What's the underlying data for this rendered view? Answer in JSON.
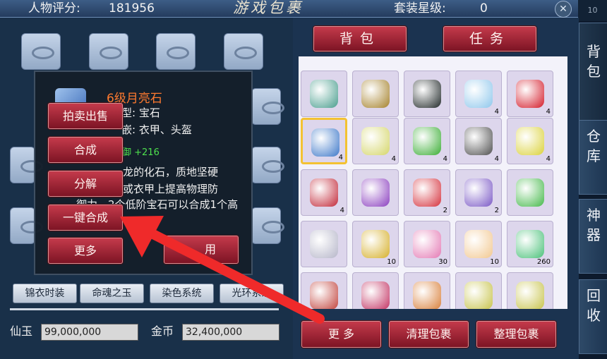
{
  "header": {
    "rating_label": "人物评分:",
    "rating_value": "181956",
    "title": "游戏包裹",
    "set_level_label": "套装星级:",
    "set_level_value": "0",
    "close_symbol": "✕",
    "edge_text": "10"
  },
  "tooltip": {
    "name": "6级月亮石",
    "type_line": "型: 宝石",
    "inlay_line": "嵌: 衣甲、头盔",
    "bonus": "御 +216",
    "desc_l1": "龙的化石，质地坚硬",
    "desc_l2": "或衣甲上提高物理防",
    "desc_l3": "御力。2个低阶宝石可以合成1个高",
    "desc_l4": "用"
  },
  "context_menu": {
    "auction": "拍卖出售",
    "compose": "合成",
    "split": "分解",
    "one_key_compose": "一键合成",
    "more": "更多"
  },
  "left_tabs": [
    "锦衣时装",
    "命魂之玉",
    "染色系统",
    "光环系统"
  ],
  "currency": {
    "xianyu_label": "仙玉",
    "xianyu_value": "99,000,000",
    "gold_label": "金币",
    "gold_value": "32,400,000"
  },
  "bag_tabs": {
    "bag": "背包",
    "task": "任务"
  },
  "items": [
    {
      "icon": "armor-icon",
      "count": "",
      "color": "#4a9e8e"
    },
    {
      "icon": "ring-icon",
      "count": "",
      "color": "#a5822c"
    },
    {
      "icon": "boots-icon",
      "count": "",
      "color": "#222a2a"
    },
    {
      "icon": "ice-flower-icon",
      "count": "4",
      "color": "#8ec7ec"
    },
    {
      "icon": "red-gem-icon",
      "count": "4",
      "color": "#d41c2a"
    },
    {
      "icon": "moonstone-icon",
      "count": "4",
      "color": "#3d78c9",
      "selected": true
    },
    {
      "icon": "eggs-icon",
      "count": "4",
      "color": "#d5d66a"
    },
    {
      "icon": "green-gem-icon",
      "count": "4",
      "color": "#3cae36"
    },
    {
      "icon": "black-gem-icon",
      "count": "4",
      "color": "#505050"
    },
    {
      "icon": "yellow-gem-icon",
      "count": "4",
      "color": "#dbd23b"
    },
    {
      "icon": "ruby-icon",
      "count": "4",
      "color": "#c22a3a"
    },
    {
      "icon": "purple-star-icon",
      "count": "",
      "color": "#8b3fbf"
    },
    {
      "icon": "red-star-icon",
      "count": "2",
      "color": "#d5323d"
    },
    {
      "icon": "teal-star-icon",
      "count": "2",
      "color": "#7b59c6"
    },
    {
      "icon": "green-star-icon",
      "count": "",
      "color": "#46b94b"
    },
    {
      "icon": "silver-star-icon",
      "count": "",
      "color": "#b6b6c9"
    },
    {
      "icon": "gourd-icon",
      "count": "10",
      "color": "#d6b02b"
    },
    {
      "icon": "prism-icon",
      "count": "30",
      "color": "#e47ab4"
    },
    {
      "icon": "pearl-icon",
      "count": "10",
      "color": "#f2c890"
    },
    {
      "icon": "green-crystal-icon",
      "count": "260",
      "color": "#4ac179"
    },
    {
      "icon": "fruit-tree-icon",
      "count": "",
      "color": "#c1433c"
    },
    {
      "icon": "treasure-box-icon",
      "count": "",
      "color": "#c23262"
    },
    {
      "icon": "twin-sprout-icon",
      "count": "",
      "color": "#d9803a"
    },
    {
      "icon": "sprout-icon",
      "count": "",
      "color": "#c7c34a"
    },
    {
      "icon": "sprout-icon-2",
      "count": "",
      "color": "#c7c34a"
    }
  ],
  "bottom_buttons": {
    "more": "更 多",
    "clean": "清理包裹",
    "sort": "整理包裹"
  },
  "side_tabs": [
    {
      "l1": "背",
      "l2": "包"
    },
    {
      "l1": "仓",
      "l2": "库"
    },
    {
      "l1": "神",
      "l2": "器"
    },
    {
      "l1": "回",
      "l2": "收"
    }
  ],
  "colors": {
    "red_button": "#a32233",
    "arrow": "#ef2a2a",
    "selected_border": "#f3c232"
  }
}
